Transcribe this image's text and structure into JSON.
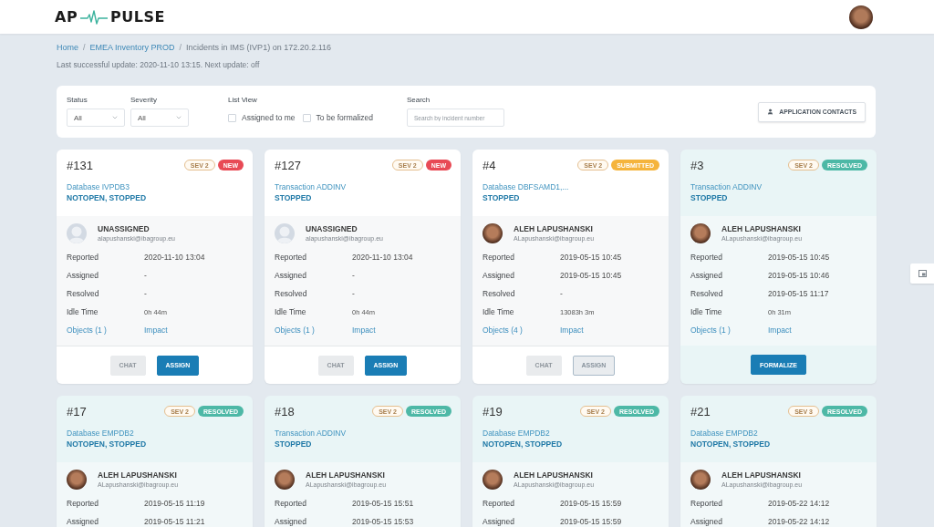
{
  "header": {
    "logo": {
      "left": "AP",
      "right": "PULSE"
    }
  },
  "breadcrumbs": [
    {
      "kind": "link",
      "text": "Home"
    },
    {
      "kind": "separator",
      "text": "/"
    },
    {
      "kind": "link",
      "text": "EMEA Inventory PROD"
    },
    {
      "kind": "separator",
      "text": "/"
    },
    {
      "kind": "current",
      "text": "Incidents in IMS (IVP1) on 172.20.2.116"
    }
  ],
  "update_info": "Last successful update: 2020-11-10 13:15. Next update: off",
  "filters": {
    "status": {
      "label": "Status",
      "value": "All"
    },
    "severity": {
      "label": "Severity",
      "value": "All"
    },
    "list_view": {
      "label": "List View",
      "options": [
        {
          "label": "Assigned to me",
          "checked": false
        },
        {
          "label": "To be formalized",
          "checked": false
        }
      ]
    },
    "search": {
      "label": "Search",
      "placeholder": "Search by incident number"
    },
    "contacts_button": {
      "label": "APPLICATION CONTACTS"
    }
  },
  "cards": [
    {
      "number": "#131",
      "severity": "SEV 2",
      "status": {
        "text": "NEW",
        "color": "#e84a55"
      },
      "resolved": false,
      "title": "Database IVPDB3",
      "state": "NOTOPEN, STOPPED",
      "assignee": {
        "name": "UNASSIGNED",
        "email": "alapushanski@ibagroup.eu",
        "photo": false
      },
      "rows": [
        {
          "kind": "field",
          "label": "Reported",
          "value": "2020-11-10 13:04"
        },
        {
          "kind": "field",
          "label": "Assigned",
          "value": "-"
        },
        {
          "kind": "field",
          "label": "Resolved",
          "value": "-"
        },
        {
          "kind": "duration",
          "label": "Idle Time",
          "value": "0h 44m"
        },
        {
          "kind": "links",
          "label": "Objects (1 )",
          "value": "Impact"
        }
      ],
      "buttons": [
        {
          "label": "CHAT",
          "kind": "secondary",
          "disabled": true
        },
        {
          "label": "ASSIGN",
          "kind": "primary",
          "disabled": false
        }
      ]
    },
    {
      "number": "#127",
      "severity": "SEV 2",
      "status": {
        "text": "NEW",
        "color": "#e84a55"
      },
      "resolved": false,
      "title": "Transaction ADDINV",
      "state": "STOPPED",
      "assignee": {
        "name": "UNASSIGNED",
        "email": "alapushanski@ibagroup.eu",
        "photo": false
      },
      "rows": [
        {
          "kind": "field",
          "label": "Reported",
          "value": "2020-11-10 13:04"
        },
        {
          "kind": "field",
          "label": "Assigned",
          "value": "-"
        },
        {
          "kind": "field",
          "label": "Resolved",
          "value": "-"
        },
        {
          "kind": "duration",
          "label": "Idle Time",
          "value": "0h 44m"
        },
        {
          "kind": "links",
          "label": "Objects (1 )",
          "value": "Impact"
        }
      ],
      "buttons": [
        {
          "label": "CHAT",
          "kind": "secondary",
          "disabled": true
        },
        {
          "label": "ASSIGN",
          "kind": "primary",
          "disabled": false
        }
      ]
    },
    {
      "number": "#4",
      "severity": "SEV 2",
      "status": {
        "text": "SUBMITTED",
        "color": "#f5b43c"
      },
      "resolved": false,
      "title": "Database DBFSAMD1,...",
      "state": "STOPPED",
      "assignee": {
        "name": "ALEH LAPUSHANSKI",
        "email": "ALapushanski@ibagroup.eu",
        "photo": true
      },
      "rows": [
        {
          "kind": "field",
          "label": "Reported",
          "value": "2019-05-15 10:45"
        },
        {
          "kind": "field",
          "label": "Assigned",
          "value": "2019-05-15 10:45"
        },
        {
          "kind": "field",
          "label": "Resolved",
          "value": "-"
        },
        {
          "kind": "duration",
          "label": "Idle Time",
          "value": "13083h 3m"
        },
        {
          "kind": "links",
          "label": "Objects (4 )",
          "value": "Impact"
        }
      ],
      "buttons": [
        {
          "label": "CHAT",
          "kind": "secondary",
          "disabled": true
        },
        {
          "label": "ASSIGN",
          "kind": "primary",
          "disabled": true
        }
      ]
    },
    {
      "number": "#3",
      "severity": "SEV 2",
      "status": {
        "text": "RESOLVED",
        "color": "#4db8a6"
      },
      "resolved": true,
      "title": "Transaction ADDINV",
      "state": "STOPPED",
      "assignee": {
        "name": "ALEH LAPUSHANSKI",
        "email": "ALapushanski@ibagroup.eu",
        "photo": true
      },
      "rows": [
        {
          "kind": "field",
          "label": "Reported",
          "value": "2019-05-15 10:45"
        },
        {
          "kind": "field",
          "label": "Assigned",
          "value": "2019-05-15 10:46"
        },
        {
          "kind": "field",
          "label": "Resolved",
          "value": "2019-05-15 11:17"
        },
        {
          "kind": "duration",
          "label": "Idle Time",
          "value": "0h 31m"
        },
        {
          "kind": "links",
          "label": "Objects (1 )",
          "value": "Impact"
        }
      ],
      "buttons": [
        {
          "label": "FORMALIZE",
          "kind": "primary",
          "disabled": false
        }
      ]
    },
    {
      "number": "#17",
      "severity": "SEV 2",
      "status": {
        "text": "RESOLVED",
        "color": "#4db8a6"
      },
      "resolved": true,
      "title": "Database EMPDB2",
      "state": "NOTOPEN, STOPPED",
      "assignee": {
        "name": "ALEH LAPUSHANSKI",
        "email": "ALapushanski@ibagroup.eu",
        "photo": true
      },
      "rows": [
        {
          "kind": "field",
          "label": "Reported",
          "value": "2019-05-15 11:19"
        },
        {
          "kind": "field",
          "label": "Assigned",
          "value": "2019-05-15 11:21"
        }
      ]
    },
    {
      "number": "#18",
      "severity": "SEV 2",
      "status": {
        "text": "RESOLVED",
        "color": "#4db8a6"
      },
      "resolved": true,
      "title": "Transaction ADDINV",
      "state": "STOPPED",
      "assignee": {
        "name": "ALEH LAPUSHANSKI",
        "email": "ALapushanski@ibagroup.eu",
        "photo": true
      },
      "rows": [
        {
          "kind": "field",
          "label": "Reported",
          "value": "2019-05-15 15:51"
        },
        {
          "kind": "field",
          "label": "Assigned",
          "value": "2019-05-15 15:53"
        }
      ]
    },
    {
      "number": "#19",
      "severity": "SEV 2",
      "status": {
        "text": "RESOLVED",
        "color": "#4db8a6"
      },
      "resolved": true,
      "title": "Database EMPDB2",
      "state": "NOTOPEN, STOPPED",
      "assignee": {
        "name": "ALEH LAPUSHANSKI",
        "email": "ALapushanski@ibagroup.eu",
        "photo": true
      },
      "rows": [
        {
          "kind": "field",
          "label": "Reported",
          "value": "2019-05-15 15:59"
        },
        {
          "kind": "field",
          "label": "Assigned",
          "value": "2019-05-15 15:59"
        }
      ]
    },
    {
      "number": "#21",
      "severity": "SEV 3",
      "status": {
        "text": "RESOLVED",
        "color": "#4db8a6"
      },
      "resolved": true,
      "title": "Database EMPDB2",
      "state": "NOTOPEN, STOPPED",
      "assignee": {
        "name": "ALEH LAPUSHANSKI",
        "email": "ALapushanski@ibagroup.eu",
        "photo": true
      },
      "rows": [
        {
          "kind": "field",
          "label": "Reported",
          "value": "2019-05-22 14:12"
        },
        {
          "kind": "field",
          "label": "Assigned",
          "value": "2019-05-22 14:12"
        }
      ]
    }
  ]
}
